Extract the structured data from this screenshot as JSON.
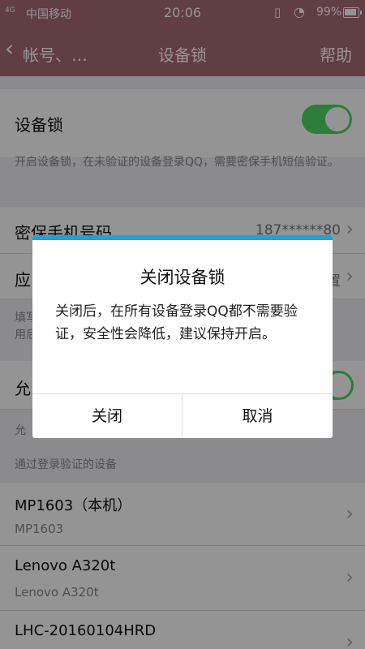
{
  "status_bar": {
    "signal": "4G",
    "carrier": "中国移动",
    "time": "20:06",
    "vibrate_icon": "vibrate-icon",
    "wifi_icon": "wifi-icon",
    "battery": "99%"
  },
  "nav": {
    "back_label": "帐号、…",
    "title": "设备锁",
    "help": "帮助"
  },
  "device_lock": {
    "label": "设备锁",
    "enabled": true,
    "description": "开启设备锁，在未验证的设备登录QQ，需要密保手机短信验证。"
  },
  "phone_row": {
    "label": "密保手机号码",
    "value": "187******80"
  },
  "emergency_row": {
    "label": "应",
    "value": "置"
  },
  "emergency_desc": "填写\n用后",
  "allow_row": {
    "label": "允"
  },
  "allow_desc": "允",
  "verified_header": "通过登录验证的设备",
  "devices": [
    {
      "name": "MP1603（本机）",
      "model": "MP1603"
    },
    {
      "name": "Lenovo A320t",
      "model": "Lenovo A320t"
    },
    {
      "name": "LHC-20160104HRD",
      "model": ""
    }
  ],
  "dialog": {
    "title": "关闭设备锁",
    "message": "关闭后，在所有设备登录QQ都不需要验证，安全性会降低，建议保持开启。",
    "close_button": "关闭",
    "cancel_button": "取消"
  },
  "colors": {
    "header": "#a86a76",
    "toggle_on": "#4cd964",
    "dialog_accent": "#1aa3dc"
  }
}
